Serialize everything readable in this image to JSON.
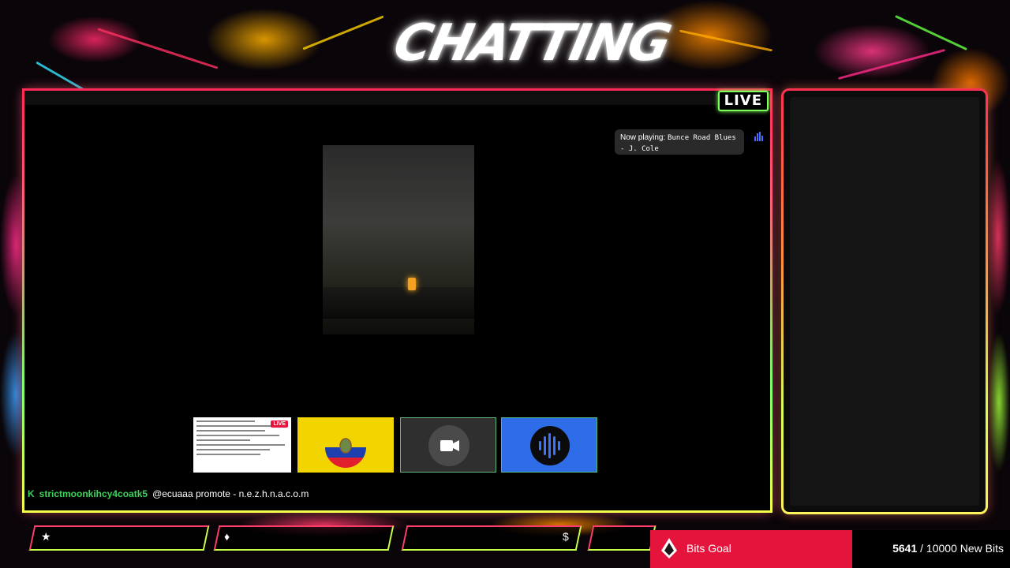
{
  "overlay": {
    "title": "CHATTING",
    "live_badge": "LIVE"
  },
  "now_playing": {
    "prefix": "Now playing:",
    "track": "Bunce Road Blues",
    "artist": "- J. Cole"
  },
  "chat": {
    "badge": "K",
    "username": "strictmoonkihcy4coatk5",
    "message": "@ecuaaa promote - n.e.z.h.n.a.c.o.m"
  },
  "thumbnails": [
    {
      "label": "chat-preview",
      "live_tag": "LIVE"
    },
    {
      "label": "ecuador-flag"
    },
    {
      "label": "camera"
    },
    {
      "label": "audio"
    }
  ],
  "bottom_panels": [
    {
      "icon": "star-icon",
      "glyph": "★"
    },
    {
      "icon": "diamond-icon",
      "glyph": "♦"
    },
    {
      "icon": "dollar-icon",
      "glyph": "$"
    }
  ],
  "bits_goal": {
    "label": "Bits Goal",
    "current": "5641",
    "separator": " / 10000 New Bits",
    "current_value": 5641,
    "target_value": 10000,
    "color": "#e5143c"
  }
}
